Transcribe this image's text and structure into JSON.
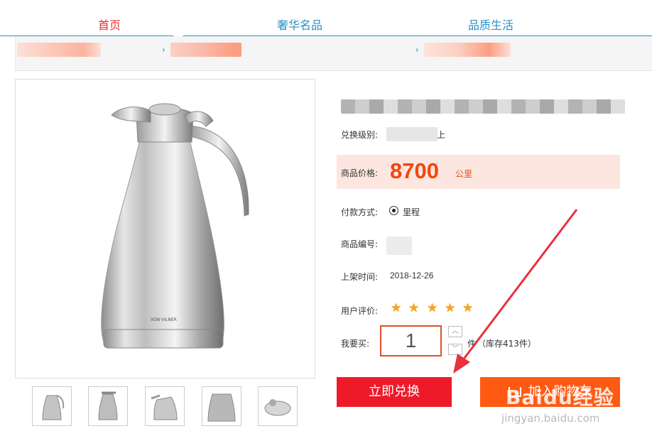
{
  "nav": {
    "tabs": [
      {
        "label": "首页",
        "color": "#e5322d"
      },
      {
        "label": "奢华名品",
        "color": "#2b8fc9"
      },
      {
        "label": "品质生活",
        "color": "#2b8fc9"
      }
    ]
  },
  "breadcrumb": {
    "separator": "›"
  },
  "product": {
    "exchange_level_label": "兑换级别:",
    "exchange_level_suffix": "上",
    "price_label": "商品价格:",
    "price_value": "8700",
    "price_unit": "公里",
    "payment_label": "付款方式:",
    "payment_option": "里程",
    "code_label": "商品编号:",
    "listed_label": "上架时间:",
    "listed_date": "2018-12-26",
    "rating_label": "用户评价:",
    "rating": 5,
    "buy_label": "我要买:",
    "quantity": "1",
    "quantity_unit": "件",
    "stock_text": "（库存413件）",
    "image_brand_text": "VON·VILNER",
    "thumbnails": [
      "thumb-1",
      "thumb-2",
      "thumb-3",
      "thumb-4",
      "thumb-5"
    ]
  },
  "buttons": {
    "exchange_now": "立即兑换",
    "add_to_cart": "加入购物车",
    "stepper_up": "︿",
    "stepper_down": "﹀"
  },
  "watermark": {
    "brand": "Baidu经验",
    "url": "jingyan.baidu.com"
  },
  "colors": {
    "accent_blue": "#2b8fc9",
    "price_orange": "#f2460d",
    "button_red": "#ee1a2a",
    "button_orange": "#ff5a12",
    "arrow_red": "#e8323c"
  }
}
